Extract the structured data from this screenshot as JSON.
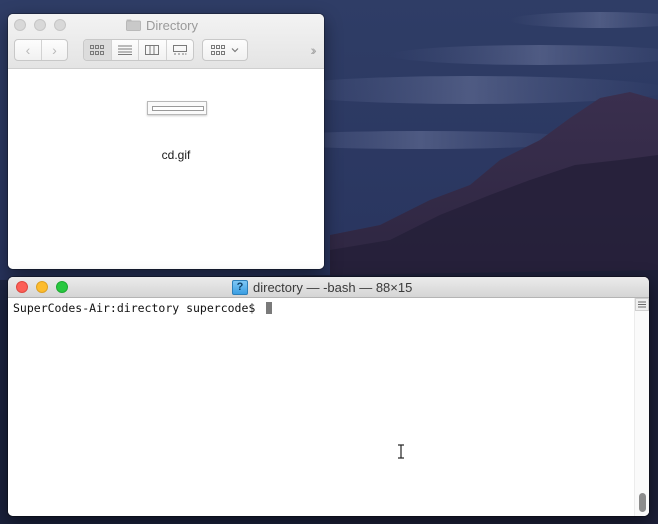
{
  "finder": {
    "title": "Directory",
    "title_icon": "folder-icon",
    "toolbar": {
      "back_icon": "chevron-left-icon",
      "forward_icon": "chevron-right-icon",
      "back_glyph": "‹",
      "forward_glyph": "›",
      "views": [
        "icon-view",
        "list-view",
        "column-view",
        "gallery-view"
      ],
      "active_view": "icon-view",
      "arrange_icon": "group-arrange-icon",
      "more_glyph": "››"
    },
    "files": [
      {
        "name": "cd.gif",
        "icon": "gif-thumbnail-icon"
      }
    ]
  },
  "terminal": {
    "title": "directory — -bash — 88×15",
    "title_icon": "document-proxy-icon",
    "title_icon_glyph": "?",
    "prompt": "SuperCodes-Air:directory supercode$ ",
    "cursor_icon": "block-cursor-icon",
    "pointer_icon": "ibeam-cursor-icon"
  },
  "colors": {
    "close": "#fc5f57",
    "minimize": "#fdbc2e",
    "zoom": "#28c840",
    "inactive_light": "#d8d8d8"
  }
}
